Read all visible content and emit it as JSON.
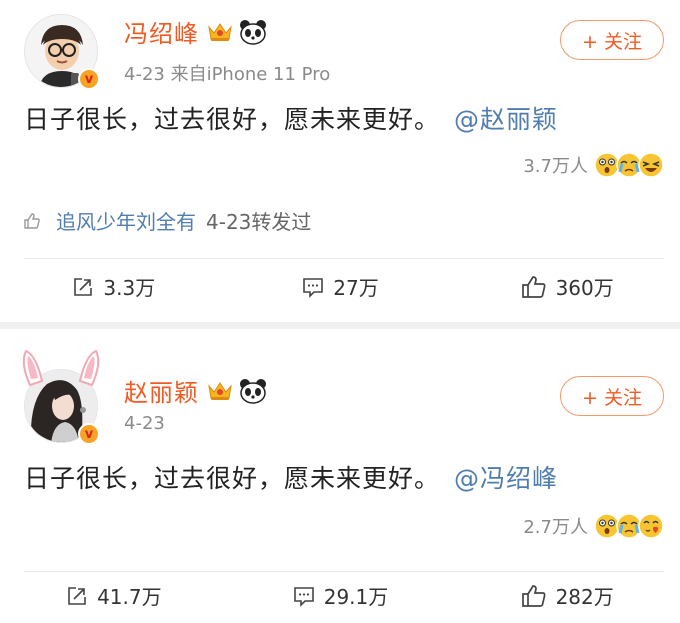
{
  "posts": [
    {
      "author": "冯绍峰",
      "meta": "4-23  来自iPhone 11 Pro",
      "follow_label": "+ 关注",
      "text": "日子很长，过去很好，愿未来更好。",
      "mention": "@赵丽颖",
      "reaction_count": "3.7万人",
      "repost_user": "追风少年刘全有",
      "repost_rest": "4-23转发过",
      "share_count": "3.3万",
      "comment_count": "27万",
      "like_count": "360万"
    },
    {
      "author": "赵丽颖",
      "meta": "4-23",
      "follow_label": "+ 关注",
      "text": "日子很长，过去很好，愿未来更好。",
      "mention": "@冯绍峰",
      "reaction_count": "2.7万人",
      "share_count": "41.7万",
      "comment_count": "29.1万",
      "like_count": "282万"
    }
  ],
  "badge": {
    "label": "v",
    "color": "#f7a325"
  },
  "colors": {
    "name": "#f15a22",
    "link": "#507daf",
    "muted": "#8a8a8a"
  },
  "icons": [
    "crown-icon",
    "panda-icon",
    "share-icon",
    "comment-icon",
    "like-icon",
    "thumb-icon"
  ]
}
